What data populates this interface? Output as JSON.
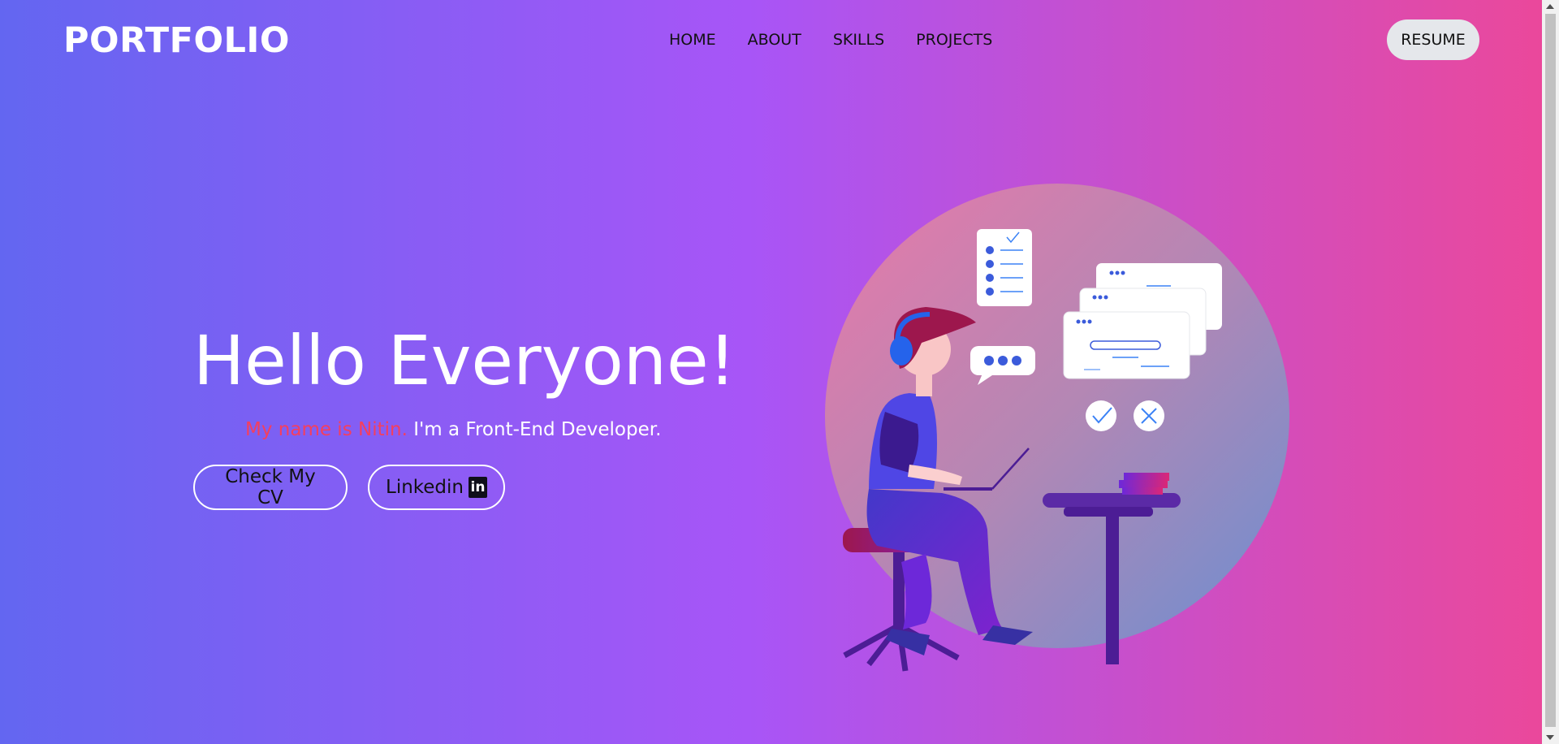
{
  "header": {
    "logo": "PORTFOLIO",
    "nav": [
      "HOME",
      "ABOUT",
      "SKILLS",
      "PROJECTS"
    ],
    "resume_label": "RESUME"
  },
  "hero": {
    "title": "Hello Everyone!",
    "name_text": "My name is Nitin.",
    "role_text": " I'm a Front-End Developer.",
    "cv_button": "Check My CV",
    "linkedin_button": "Linkedin",
    "linkedin_icon_text": "in"
  },
  "icons": {
    "linkedin": "linkedin-icon",
    "illustration": "developer-at-laptop-illustration"
  },
  "colors": {
    "gradient_start": "#6366f1",
    "gradient_mid": "#a855f7",
    "gradient_end": "#ec4899",
    "name_highlight": "#f43f5e"
  }
}
